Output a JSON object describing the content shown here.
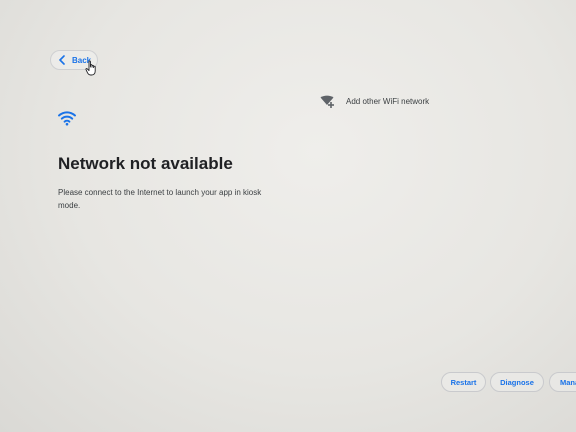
{
  "header": {
    "back_label": "Back"
  },
  "network_error": {
    "title": "Network not available",
    "description": "Please connect to the Internet to launch your app in kiosk mode."
  },
  "add_network": {
    "label": "Add other WiFi network"
  },
  "footer": {
    "restart_label": "Restart",
    "diagnose_label": "Diagnose",
    "manage_label": "Mana"
  },
  "icons": {
    "back": "chevron-left-icon",
    "cursor": "hand-pointer-cursor",
    "wifi": "wifi-icon",
    "add_wifi": "wifi-add-icon"
  },
  "colors": {
    "accent": "#1a73e8",
    "title": "#202124",
    "text": "#3c4043",
    "background": "#e7e6e2"
  }
}
